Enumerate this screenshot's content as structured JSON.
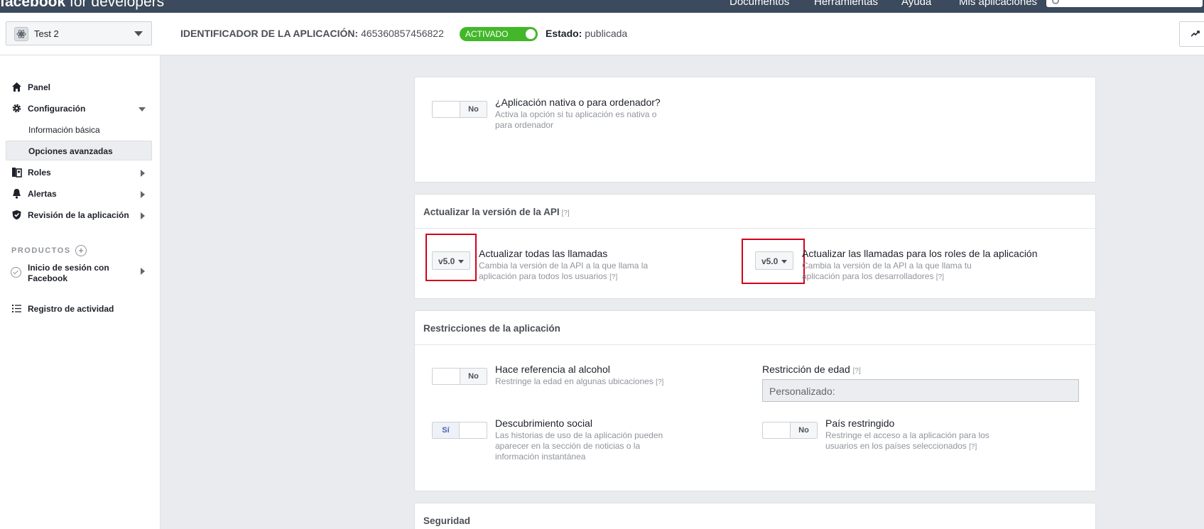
{
  "topbar": {
    "logo_brand": "facebook",
    "logo_suffix": "for developers",
    "nav": [
      "Documentos",
      "Herramientas",
      "Ayuda",
      "Mis aplicaciones"
    ]
  },
  "appbar": {
    "app_name": "Test 2",
    "app_id_label": "IDENTIFICADOR DE LA APLICACIÓN:",
    "app_id_value": "465360857456822",
    "toggle_label": "ACTIVADO",
    "status_label": "Estado:",
    "status_value": "publicada"
  },
  "sidebar": {
    "panel": "Panel",
    "config": "Configuración",
    "config_sub": [
      "Información básica",
      "Opciones avanzadas"
    ],
    "roles": "Roles",
    "alerts": "Alertas",
    "review": "Revisión de la aplicación",
    "products_header": "PRODUCTOS",
    "fb_login_line1": "Inicio de sesión con",
    "fb_login_line2": "Facebook",
    "activity": "Registro de actividad"
  },
  "native": {
    "toggle": "No",
    "title": "¿Aplicación nativa o para ordenador?",
    "desc_line1": "Activa la opción si tu aplicación es nativa o",
    "desc_line2": "para ordenador"
  },
  "api": {
    "title": "Actualizar la versión de la API",
    "hint": "[?]",
    "all_calls": {
      "version": "v5.0",
      "title": "Actualizar todas las llamadas",
      "desc_line1": "Cambia la versión de la API a la que llama la",
      "desc_line2": "aplicación para todos los usuarios",
      "hint": "[?]"
    },
    "role_calls": {
      "version": "v5.0",
      "title": "Actualizar las llamadas para los roles de la aplicación",
      "desc_line1": "Cambia la versión de la API a la que llama tu",
      "desc_line2": "aplicación para los desarrolladores",
      "hint": "[?]"
    }
  },
  "restrictions": {
    "title": "Restricciones de la aplicación",
    "alcohol": {
      "toggle": "No",
      "title": "Hace referencia al alcohol",
      "desc": "Restringe la edad en algunas ubicaciones",
      "hint": "[?]"
    },
    "age": {
      "title": "Restricción de edad",
      "hint": "[?]",
      "value": "Personalizado:"
    },
    "social": {
      "toggle": "Sí",
      "title": "Descubrimiento social",
      "desc_line1": "Las historias de uso de la aplicación pueden",
      "desc_line2": "aparecer en la sección de noticias o la",
      "desc_line3": "información instantánea"
    },
    "country": {
      "toggle": "No",
      "title": "País restringido",
      "desc_line1": "Restringe el acceso a la aplicación para los",
      "desc_line2": "usuarios en los países seleccionados",
      "hint": "[?]"
    }
  },
  "security": {
    "title": "Seguridad"
  }
}
